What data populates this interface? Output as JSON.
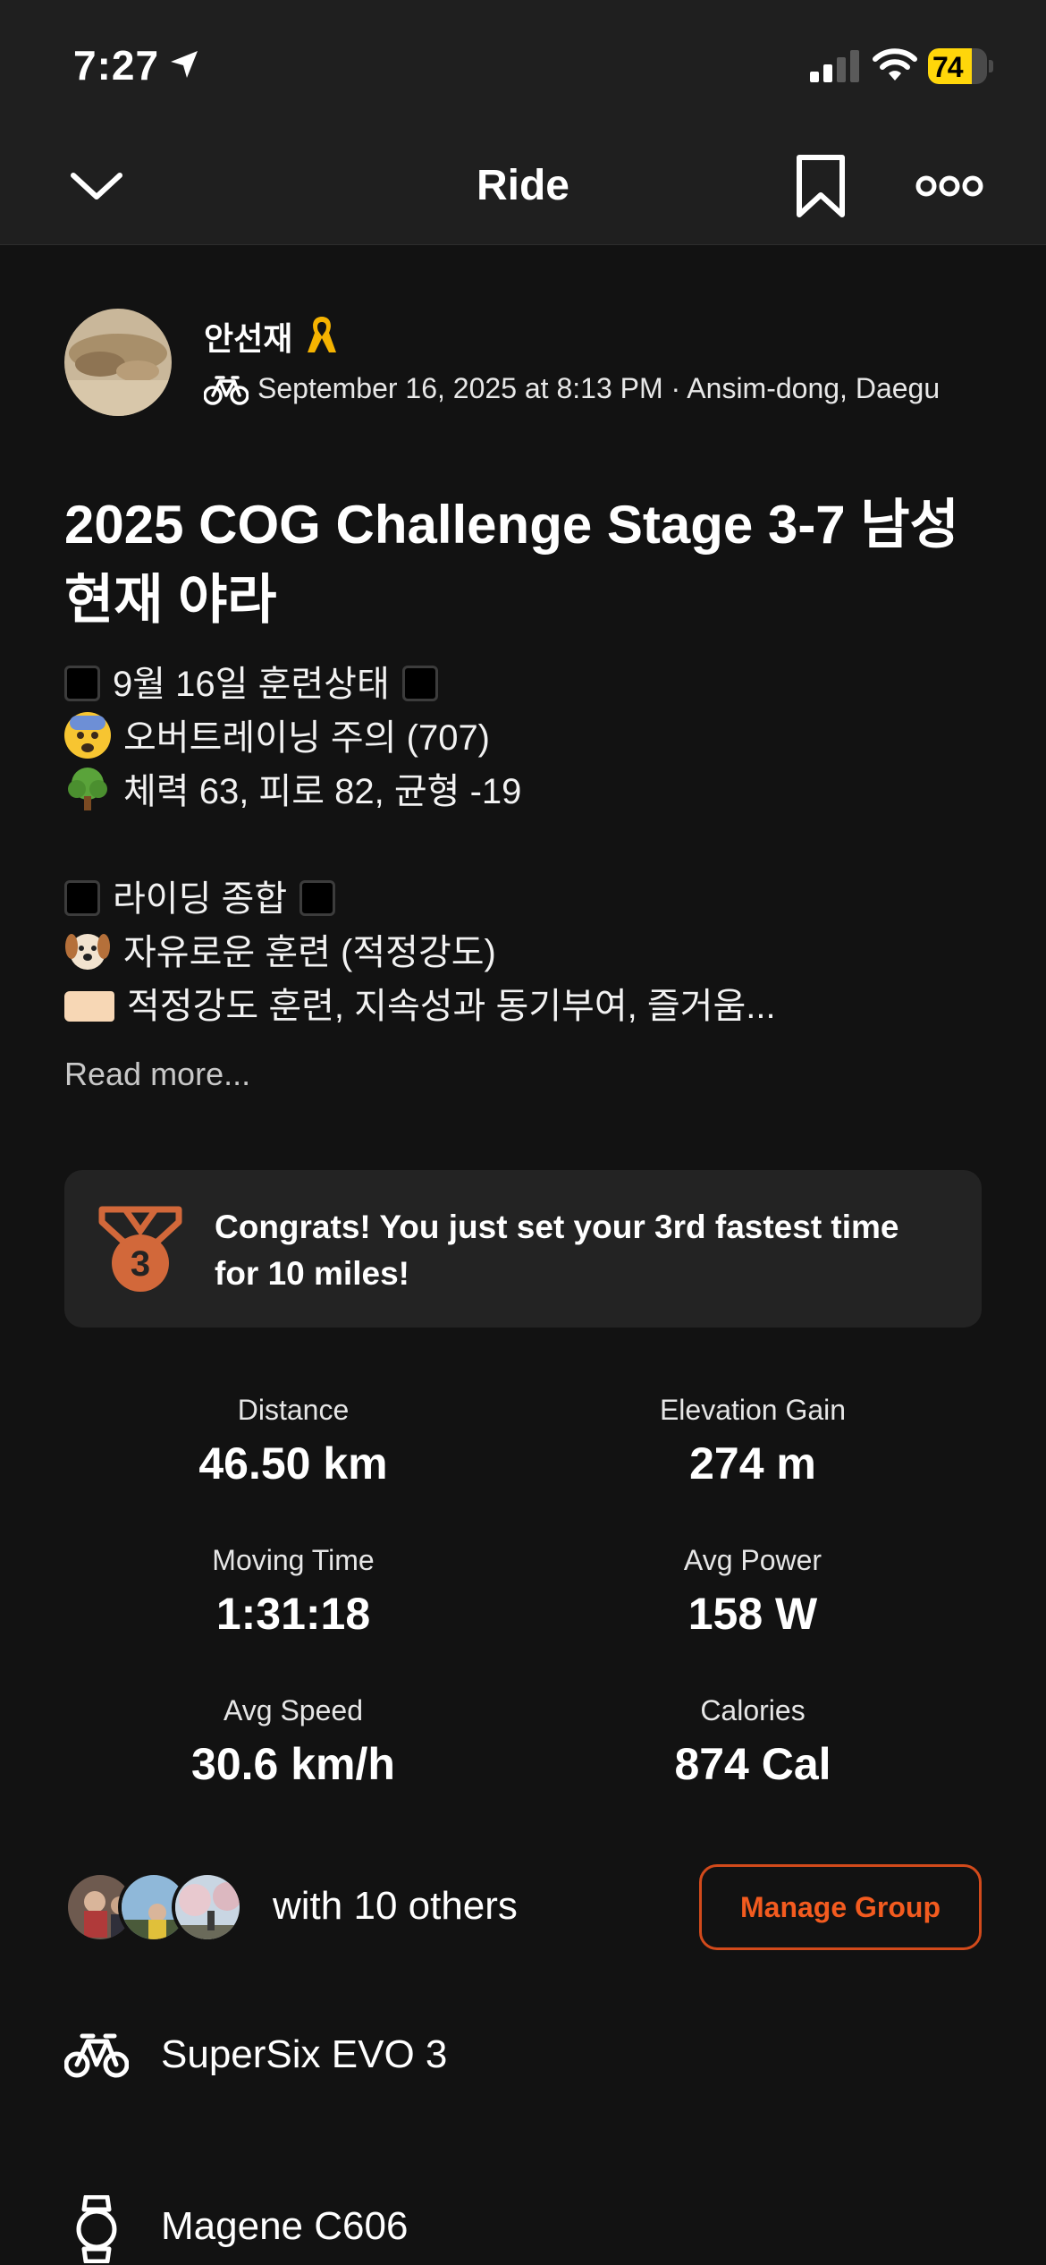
{
  "status_bar": {
    "time": "7:27",
    "battery": "74",
    "battery_level": 0.74
  },
  "nav": {
    "title": "Ride"
  },
  "athlete": {
    "name": "안선재",
    "meta": "September 16, 2025 at 8:13 PM · Ansim-dong, Daegu"
  },
  "activity": {
    "title": "2025 COG Challenge Stage 3-7 남성현재 야라",
    "description": [
      "9월 16일 훈련상태",
      "오버트레이닝 주의 (707)",
      "체력 63, 피로 82, 균형 -19",
      "라이딩 종합",
      "자유로운 훈련 (적정강도)",
      "적정강도 훈련, 지속성과 동기부여, 즐거움..."
    ],
    "read_more": "Read more..."
  },
  "achievement": {
    "medal_rank": "3",
    "text": "Congrats! You just set your 3rd fastest time for 10 miles!"
  },
  "stats": [
    {
      "label": "Distance",
      "value": "46.50 km"
    },
    {
      "label": "Elevation Gain",
      "value": "274 m"
    },
    {
      "label": "Moving Time",
      "value": "1:31:18"
    },
    {
      "label": "Avg Power",
      "value": "158 W"
    },
    {
      "label": "Avg Speed",
      "value": "30.6 km/h"
    },
    {
      "label": "Calories",
      "value": "874 Cal"
    }
  ],
  "group": {
    "with_text": "with 10 others",
    "manage_label": "Manage Group"
  },
  "gear": {
    "bike": "SuperSix EVO 3",
    "device": "Magene C606"
  },
  "colors": {
    "background": "#121212",
    "header": "#1f1f1f",
    "card": "#232323",
    "accent": "#f35b1f",
    "medal": "#d2683a",
    "battery": "#ffd60a"
  },
  "icons": [
    "location-arrow-icon",
    "signal-icon",
    "wifi-icon",
    "battery-icon",
    "chevron-down-icon",
    "bookmark-icon",
    "more-icon",
    "ribbon-icon",
    "bike-icon",
    "medal-icon",
    "watch-icon"
  ]
}
